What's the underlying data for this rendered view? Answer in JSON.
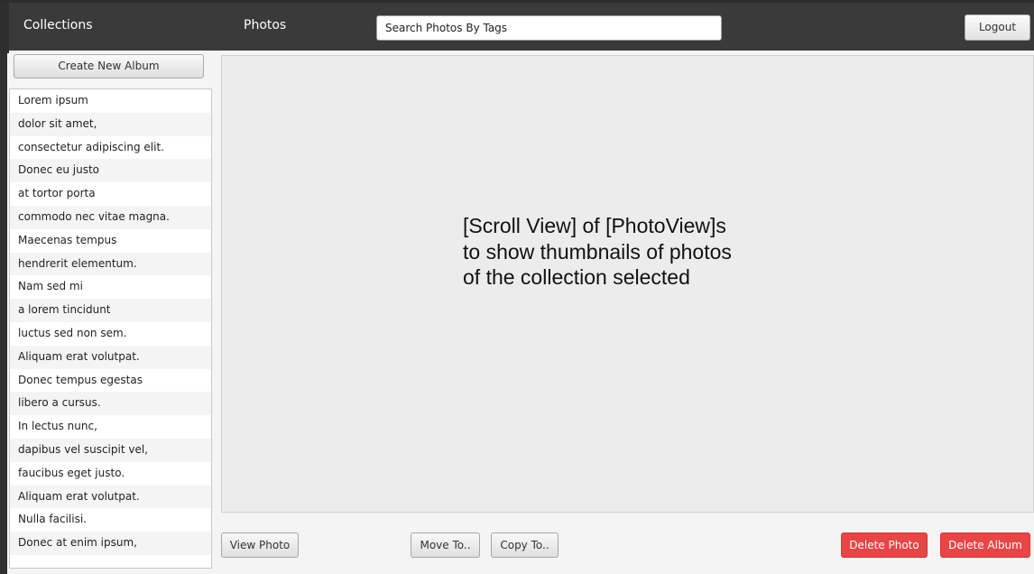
{
  "header": {
    "collections_label": "Collections",
    "photos_label": "Photos",
    "search_placeholder": "Search Photos By Tags",
    "logout_label": "Logout"
  },
  "sidebar": {
    "create_album_label": "Create New Album",
    "albums": [
      "Lorem ipsum",
      "dolor sit amet,",
      "consectetur adipiscing elit.",
      "Donec eu justo",
      "at tortor porta",
      "commodo nec vitae magna.",
      "Maecenas tempus",
      "hendrerit elementum.",
      "Nam sed mi",
      "a lorem tincidunt",
      "luctus sed non sem.",
      "Aliquam erat volutpat.",
      "Donec tempus egestas",
      "libero a cursus.",
      "In lectus nunc,",
      "dapibus vel suscipit vel,",
      "faucibus eget justo.",
      "Aliquam erat volutpat.",
      "Nulla facilisi.",
      "Donec at enim ipsum,"
    ]
  },
  "main": {
    "placeholder_text": "[Scroll View] of [PhotoView]s\nto show thumbnails of photos\nof the collection selected"
  },
  "actions": {
    "view_photo_label": "View Photo",
    "move_to_label": "Move To..",
    "copy_to_label": "Copy To..",
    "delete_photo_label": "Delete Photo",
    "delete_album_label": "Delete Album"
  },
  "colors": {
    "topbar": "#3a3a3a",
    "danger": "#e84545",
    "panel": "#ececec"
  }
}
